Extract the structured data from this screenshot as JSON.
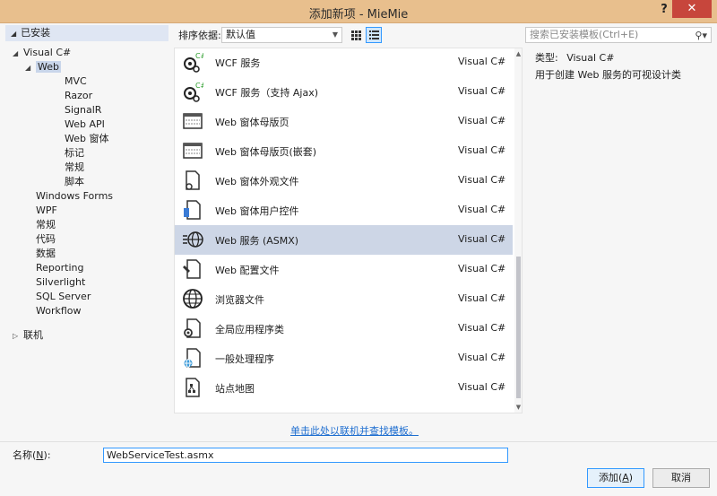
{
  "window": {
    "title": "添加新项 - MieMie",
    "help_label": "?",
    "close_label": "✕"
  },
  "tree": {
    "section_label": "已安装",
    "items": [
      {
        "label": "Visual C#",
        "level": 1,
        "arrow": "◢"
      },
      {
        "label": "Web",
        "level": 2,
        "arrow": "◢",
        "selected": true
      },
      {
        "label": "MVC",
        "level": 3
      },
      {
        "label": "Razor",
        "level": 3
      },
      {
        "label": "SignalR",
        "level": 3
      },
      {
        "label": "Web API",
        "level": 3
      },
      {
        "label": "Web 窗体",
        "level": 3
      },
      {
        "label": "标记",
        "level": 3
      },
      {
        "label": "常规",
        "level": 3
      },
      {
        "label": "脚本",
        "level": 3
      },
      {
        "label": "Windows Forms",
        "level": 2
      },
      {
        "label": "WPF",
        "level": 2
      },
      {
        "label": "常规",
        "level": 2
      },
      {
        "label": "代码",
        "level": 2
      },
      {
        "label": "数据",
        "level": 2
      },
      {
        "label": "Reporting",
        "level": 2
      },
      {
        "label": "Silverlight",
        "level": 2
      },
      {
        "label": "SQL Server",
        "level": 2
      },
      {
        "label": "Workflow",
        "level": 2
      }
    ],
    "online_label": "联机",
    "online_arrow": "▷"
  },
  "toolbar": {
    "sort_label": "排序依据:",
    "sort_value": "默认值",
    "search_placeholder": "搜索已安装模板(Ctrl+E)"
  },
  "templates": [
    {
      "name": "WCF 服务",
      "lang": "Visual C#",
      "icon": "wcf-service-icon"
    },
    {
      "name": "WCF 服务（支持 Ajax)",
      "lang": "Visual C#",
      "icon": "wcf-service-icon"
    },
    {
      "name": "Web 窗体母版页",
      "lang": "Visual C#",
      "icon": "master-page-icon"
    },
    {
      "name": "Web 窗体母版页(嵌套)",
      "lang": "Visual C#",
      "icon": "master-page-icon"
    },
    {
      "name": "Web 窗体外观文件",
      "lang": "Visual C#",
      "icon": "skin-file-icon"
    },
    {
      "name": "Web 窗体用户控件",
      "lang": "Visual C#",
      "icon": "user-control-icon"
    },
    {
      "name": "Web 服务 (ASMX)",
      "lang": "Visual C#",
      "icon": "web-service-icon",
      "selected": true
    },
    {
      "name": "Web 配置文件",
      "lang": "Visual C#",
      "icon": "config-file-icon"
    },
    {
      "name": "浏览器文件",
      "lang": "Visual C#",
      "icon": "browser-file-icon"
    },
    {
      "name": "全局应用程序类",
      "lang": "Visual C#",
      "icon": "global-app-icon"
    },
    {
      "name": "一般处理程序",
      "lang": "Visual C#",
      "icon": "generic-handler-icon"
    },
    {
      "name": "站点地图",
      "lang": "Visual C#",
      "icon": "sitemap-icon"
    }
  ],
  "online_link": "单击此处以联机并查找模板。",
  "details": {
    "type_label": "类型:",
    "type_value": "Visual C#",
    "description": "用于创建 Web 服务的可视设计类"
  },
  "name_field": {
    "label": "名称",
    "mnemonic": "N",
    "label_suffix": "):",
    "value": "WebServiceTest.asmx"
  },
  "buttons": {
    "add_label": "添加",
    "add_mnemonic": "A",
    "cancel_label": "取消"
  }
}
